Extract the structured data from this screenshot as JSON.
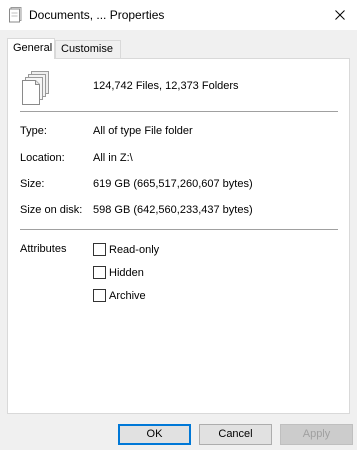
{
  "window": {
    "title": "Documents, ... Properties",
    "close_icon": "close-icon"
  },
  "tabs": [
    {
      "label": "General",
      "active": true
    },
    {
      "label": "Customise",
      "active": false
    }
  ],
  "general": {
    "contents": "124,742 Files, 12,373 Folders",
    "type_label": "Type:",
    "type_value": "All of type File folder",
    "location_label": "Location:",
    "location_value": "All in Z:\\",
    "size_label": "Size:",
    "size_value": "619 GB (665,517,260,607 bytes)",
    "size_on_disk_label": "Size on disk:",
    "size_on_disk_value": "598 GB (642,560,233,437 bytes)",
    "attributes_label": "Attributes",
    "attributes": [
      {
        "label": "Read-only",
        "checked": false
      },
      {
        "label": "Hidden",
        "checked": false
      },
      {
        "label": "Archive",
        "checked": false
      }
    ]
  },
  "buttons": {
    "ok": "OK",
    "cancel": "Cancel",
    "apply": "Apply"
  },
  "colors": {
    "accent": "#0078d7",
    "dialog_bg": "#f0f0f0",
    "panel_bg": "#ffffff"
  }
}
